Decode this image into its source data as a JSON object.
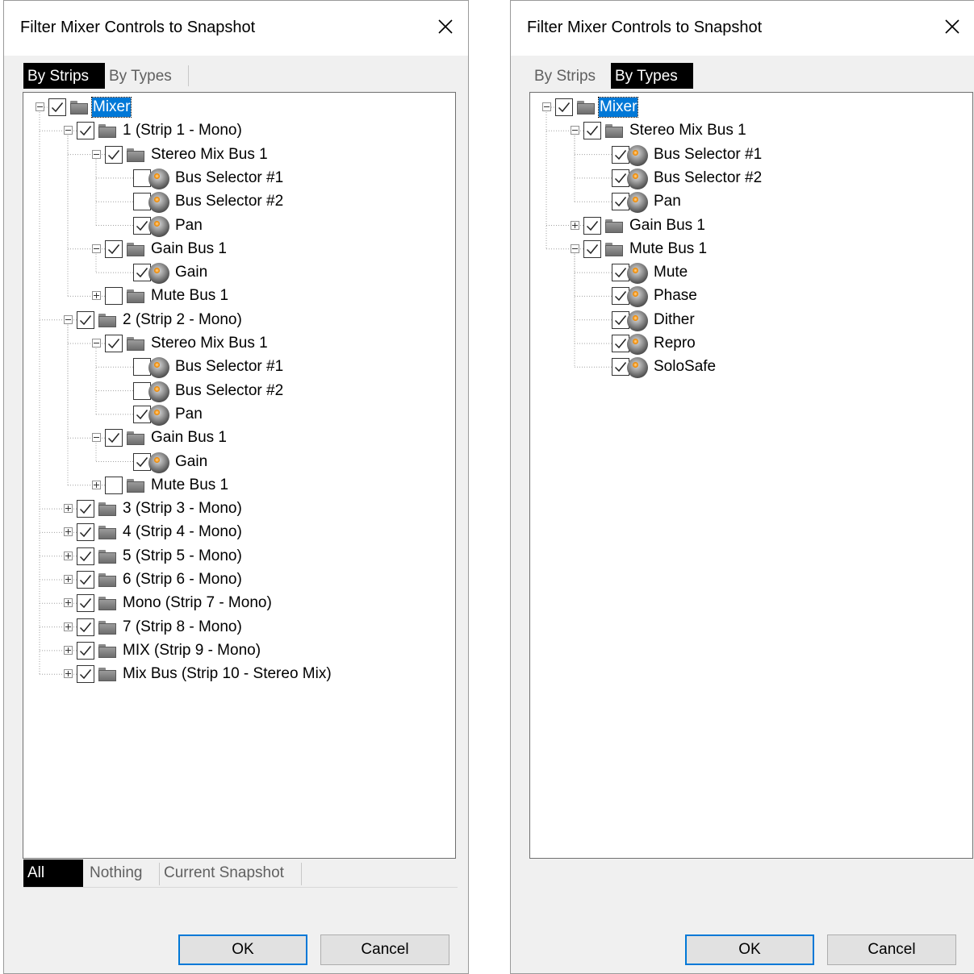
{
  "dialog_a": {
    "title": "Filter Mixer Controls to Snapshot",
    "tabs": [
      {
        "label": "By Strips",
        "active": true
      },
      {
        "label": "By Types",
        "active": false
      }
    ],
    "bottom_tabs": [
      {
        "label": "All",
        "active": true
      },
      {
        "label": "Nothing",
        "active": false
      },
      {
        "label": "Current Snapshot",
        "active": false
      }
    ],
    "ok_label": "OK",
    "cancel_label": "Cancel",
    "tree": [
      {
        "level": 0,
        "label": "Mixer",
        "type": "folder",
        "expanded": true,
        "checked": true,
        "selected": true
      },
      {
        "level": 1,
        "label": "1 (Strip 1 - Mono)",
        "type": "folder",
        "expanded": true,
        "checked": true
      },
      {
        "level": 2,
        "label": "Stereo Mix Bus 1",
        "type": "folder",
        "expanded": true,
        "checked": true
      },
      {
        "level": 3,
        "label": "Bus Selector #1",
        "type": "control",
        "checked": false
      },
      {
        "level": 3,
        "label": "Bus Selector #2",
        "type": "control",
        "checked": false
      },
      {
        "level": 3,
        "label": "Pan",
        "type": "control",
        "checked": true
      },
      {
        "level": 2,
        "label": "Gain Bus 1",
        "type": "folder",
        "expanded": true,
        "checked": true
      },
      {
        "level": 3,
        "label": "Gain",
        "type": "control",
        "checked": true
      },
      {
        "level": 2,
        "label": "Mute Bus 1",
        "type": "folder",
        "expanded": false,
        "checked": false
      },
      {
        "level": 1,
        "label": "2 (Strip 2 - Mono)",
        "type": "folder",
        "expanded": true,
        "checked": true
      },
      {
        "level": 2,
        "label": "Stereo Mix Bus 1",
        "type": "folder",
        "expanded": true,
        "checked": true
      },
      {
        "level": 3,
        "label": "Bus Selector #1",
        "type": "control",
        "checked": false
      },
      {
        "level": 3,
        "label": "Bus Selector #2",
        "type": "control",
        "checked": false
      },
      {
        "level": 3,
        "label": "Pan",
        "type": "control",
        "checked": true
      },
      {
        "level": 2,
        "label": "Gain Bus 1",
        "type": "folder",
        "expanded": true,
        "checked": true
      },
      {
        "level": 3,
        "label": "Gain",
        "type": "control",
        "checked": true
      },
      {
        "level": 2,
        "label": "Mute Bus 1",
        "type": "folder",
        "expanded": false,
        "checked": false
      },
      {
        "level": 1,
        "label": "3 (Strip 3 - Mono)",
        "type": "folder",
        "expanded": false,
        "checked": true
      },
      {
        "level": 1,
        "label": "4 (Strip 4 - Mono)",
        "type": "folder",
        "expanded": false,
        "checked": true
      },
      {
        "level": 1,
        "label": "5 (Strip 5 - Mono)",
        "type": "folder",
        "expanded": false,
        "checked": true
      },
      {
        "level": 1,
        "label": "6 (Strip 6 - Mono)",
        "type": "folder",
        "expanded": false,
        "checked": true
      },
      {
        "level": 1,
        "label": "Mono (Strip 7 - Mono)",
        "type": "folder",
        "expanded": false,
        "checked": true
      },
      {
        "level": 1,
        "label": "7 (Strip 8 - Mono)",
        "type": "folder",
        "expanded": false,
        "checked": true
      },
      {
        "level": 1,
        "label": "MIX (Strip 9 - Mono)",
        "type": "folder",
        "expanded": false,
        "checked": true
      },
      {
        "level": 1,
        "label": "Mix Bus (Strip 10 - Stereo Mix)",
        "type": "folder",
        "expanded": false,
        "checked": true
      }
    ]
  },
  "dialog_b": {
    "title": "Filter Mixer Controls to Snapshot",
    "tabs": [
      {
        "label": "By Strips",
        "active": false
      },
      {
        "label": "By Types",
        "active": true
      }
    ],
    "ok_label": "OK",
    "cancel_label": "Cancel",
    "tree": [
      {
        "level": 0,
        "label": "Mixer",
        "type": "folder",
        "expanded": true,
        "checked": true,
        "selected": true
      },
      {
        "level": 1,
        "label": "Stereo Mix Bus 1",
        "type": "folder",
        "expanded": true,
        "checked": true
      },
      {
        "level": 2,
        "label": "Bus Selector #1",
        "type": "control",
        "checked": true
      },
      {
        "level": 2,
        "label": "Bus Selector #2",
        "type": "control",
        "checked": true
      },
      {
        "level": 2,
        "label": "Pan",
        "type": "control",
        "checked": true
      },
      {
        "level": 1,
        "label": "Gain Bus 1",
        "type": "folder",
        "expanded": false,
        "checked": true
      },
      {
        "level": 1,
        "label": "Mute Bus 1",
        "type": "folder",
        "expanded": true,
        "checked": true
      },
      {
        "level": 2,
        "label": "Mute",
        "type": "control",
        "checked": true
      },
      {
        "level": 2,
        "label": "Phase",
        "type": "control",
        "checked": true
      },
      {
        "level": 2,
        "label": "Dither",
        "type": "control",
        "checked": true
      },
      {
        "level": 2,
        "label": "Repro",
        "type": "control",
        "checked": true
      },
      {
        "level": 2,
        "label": "SoloSafe",
        "type": "control",
        "checked": true
      }
    ]
  },
  "colors": {
    "selection": "#0078d7",
    "active_tab": "#000000",
    "knob_accent": "#f08a00",
    "dialog_bg": "#f0f0f0"
  },
  "icons": {
    "close": "close-icon",
    "folder": "folder-icon",
    "knob": "knob-icon",
    "expander": "expander-icon",
    "checkbox": "checkbox-icon"
  }
}
